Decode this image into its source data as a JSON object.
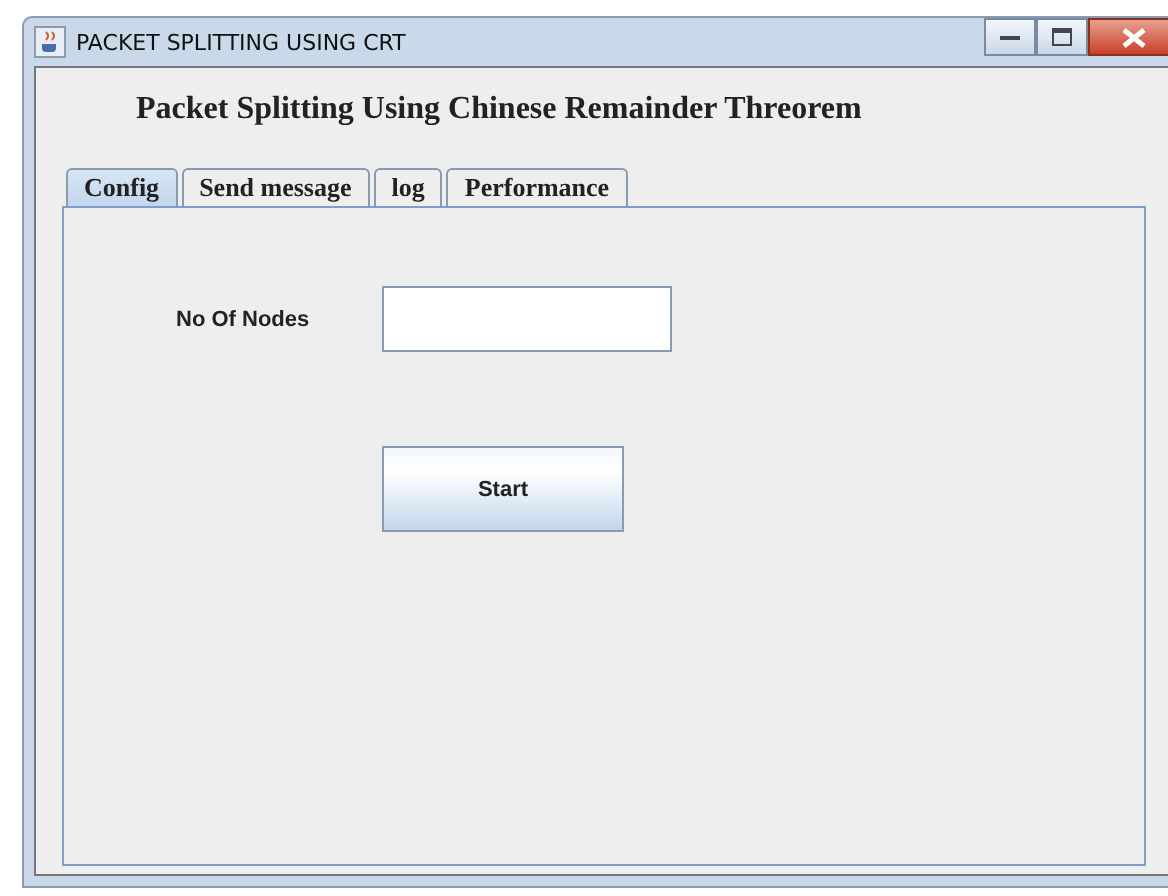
{
  "window": {
    "title": "PACKET SPLITTING USING CRT"
  },
  "heading": "Packet Splitting Using Chinese Remainder Threorem",
  "tabs": [
    {
      "label": "Config",
      "selected": true
    },
    {
      "label": "Send message",
      "selected": false
    },
    {
      "label": "log",
      "selected": false
    },
    {
      "label": "Performance",
      "selected": false
    }
  ],
  "form": {
    "label": "No Of Nodes",
    "button": "Start"
  }
}
